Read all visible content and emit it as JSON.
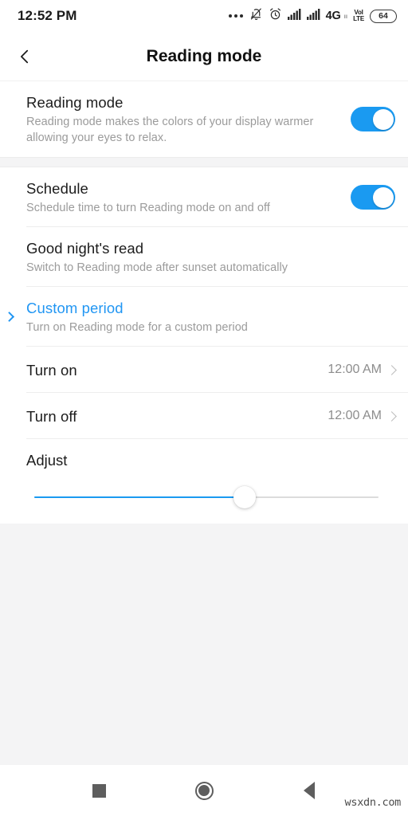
{
  "statusbar": {
    "time": "12:52 PM",
    "icons": [
      {
        "name": "more-dots-icon",
        "glyph": "•••"
      },
      {
        "name": "notification-muted-icon",
        "glyph": "muted-bell"
      },
      {
        "name": "alarm-clock-icon",
        "glyph": "alarm"
      },
      {
        "name": "signal-bars-sim1-icon",
        "glyph": "signal"
      },
      {
        "name": "signal-bars-sim2-icon",
        "glyph": "signal"
      }
    ],
    "network_type": "4G",
    "network_sub": "ıı",
    "volte_top": "VoI",
    "volte_bottom": "LTE",
    "battery_level": "64"
  },
  "appbar": {
    "back_label": "‹",
    "title": "Reading mode"
  },
  "sections": [
    {
      "rows": [
        {
          "name": "reading-mode",
          "title": "Reading mode",
          "subtitle": "Reading mode makes the colors of your display warmer allowing your eyes to relax.",
          "control": "toggle",
          "toggle_on": true
        }
      ]
    },
    {
      "rows": [
        {
          "name": "schedule",
          "title": "Schedule",
          "subtitle": "Schedule time to turn Reading mode on and off",
          "control": "toggle",
          "toggle_on": true
        },
        {
          "name": "good-nights-read",
          "title": "Good night's read",
          "subtitle": "Switch to Reading mode after sunset automatically",
          "control": "none",
          "selected": false
        },
        {
          "name": "custom-period",
          "title": "Custom period",
          "subtitle": "Turn on Reading mode for a custom period",
          "control": "none",
          "selected": true
        },
        {
          "name": "turn-on",
          "title": "Turn on",
          "value": "12:00 AM",
          "control": "chevron"
        },
        {
          "name": "turn-off",
          "title": "Turn off",
          "value": "12:00 AM",
          "control": "chevron"
        }
      ],
      "slider": {
        "name": "adjust",
        "label": "Adjust",
        "value_percent": 61
      }
    }
  ],
  "navbar": {
    "recents_label": "recents",
    "home_label": "home",
    "back_label": "back"
  },
  "watermark": "wsxdn.com",
  "colors": {
    "accent": "#1a9af1",
    "accent_text": "#2196f3",
    "title_text": "#1c1c1c",
    "sub_text": "#9b9b9b",
    "page_bg": "#f4f4f5",
    "card_bg": "#ffffff"
  }
}
